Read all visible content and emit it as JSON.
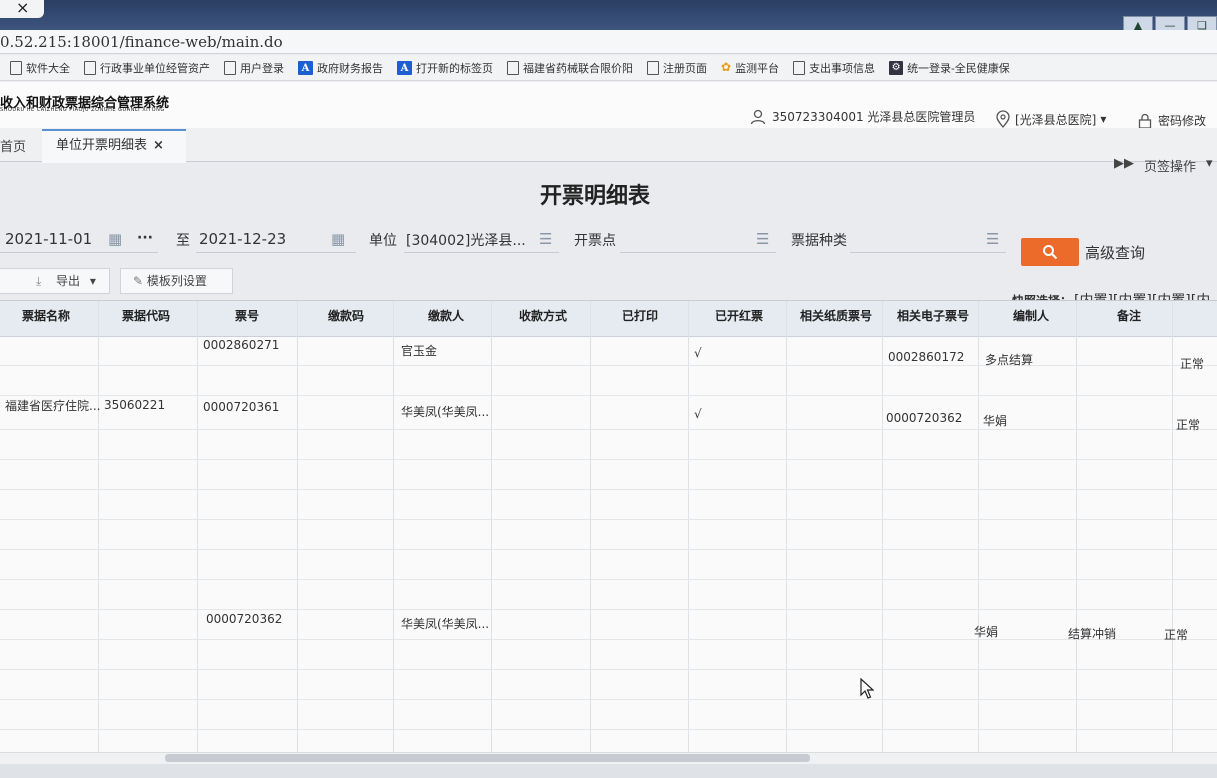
{
  "browser": {
    "tab_close": "×",
    "url": "0.52.215:18001/finance-web/main.do",
    "bookmarks": [
      {
        "label": "软件大全",
        "icon": "page-icon"
      },
      {
        "label": "行政事业单位经管资产",
        "icon": "page-icon"
      },
      {
        "label": "用户登录",
        "icon": "page-icon"
      },
      {
        "label": "政府财务报告",
        "icon": "a-icon"
      },
      {
        "label": "打开新的标签页",
        "icon": "a-icon"
      },
      {
        "label": "福建省药械联合限价阳",
        "icon": "page-icon"
      },
      {
        "label": "注册页面",
        "icon": "page-icon"
      },
      {
        "label": "监测平台",
        "icon": "flower-icon"
      },
      {
        "label": "支出事项信息",
        "icon": "page-icon"
      },
      {
        "label": "统一登录-全民健康保",
        "icon": "gear-icon"
      }
    ]
  },
  "app": {
    "logo_title": "收入和财政票据综合管理系统",
    "logo_subtitle": "SHOURU HE CAIZHENG PIAOJU ZONGHE GUANLI XITONG",
    "user": "350723304001 光泽县总医院管理员",
    "org": "[光泽县总医院]",
    "password_change": "密码修改"
  },
  "tabs": {
    "home": "首页",
    "active": "单位开票明细表",
    "close": "×",
    "tab_ops": "页签操作"
  },
  "page": {
    "title": "开票明细表"
  },
  "filters": {
    "date_from": "2021-11-01",
    "more": "···",
    "to_label": "至",
    "date_to": "2021-12-23",
    "unit_label": "单位",
    "unit_value": "[304002]光泽县...",
    "issue_point_label": "开票点",
    "bill_type_label": "票据种类",
    "advanced": "高级查询"
  },
  "toolbar": {
    "export": "导出",
    "template": "模板列设置",
    "quick_label": "快照选择：",
    "quick_values": "[内置][内置][内置][内"
  },
  "table": {
    "headers": [
      "票据名称",
      "票据代码",
      "票号",
      "缴款码",
      "缴款人",
      "收款方式",
      "已打印",
      "已开红票",
      "相关纸质票号",
      "相关电子票号",
      "编制人",
      "备注"
    ],
    "rows": [
      {
        "name": "",
        "code": "",
        "number": "0002860271",
        "payer": "官玉金",
        "red": "√",
        "e_number": "0002860172",
        "creator": "多点结算",
        "remark": "",
        "status": "正常"
      },
      {
        "name": "福建省医疗住院...",
        "code": "35060221",
        "number": "0000720361",
        "payer": "华美凤(华美凤...",
        "red": "√",
        "e_number": "0000720362",
        "creator": "华娟",
        "remark": "",
        "status": "正常"
      },
      {
        "name": "",
        "code": "",
        "number": "0000720362",
        "payer": "华美凤(华美凤...",
        "red": "",
        "e_number": "",
        "creator": "华娟",
        "remark": "结算冲销",
        "status": "正常"
      }
    ]
  },
  "colors": {
    "accent_tab": "#5b8fd6",
    "search_button": "#ec6b2a",
    "header_bg": "#e6ebf2"
  }
}
